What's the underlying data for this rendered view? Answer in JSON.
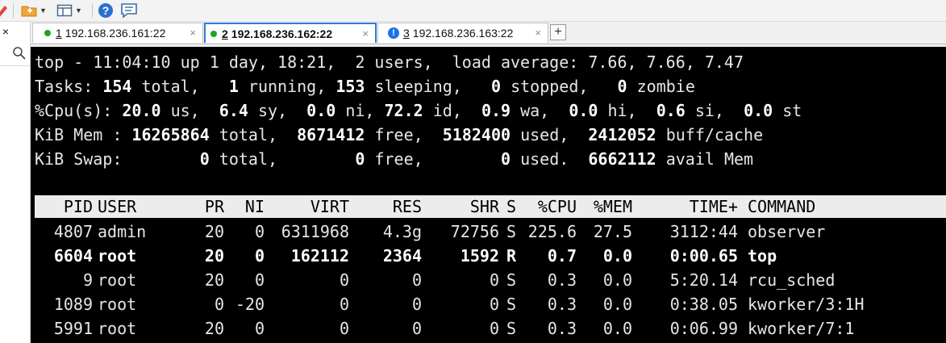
{
  "tabs": [
    {
      "num": "1",
      "label": "192.168.236.161:22",
      "status": "connected",
      "color": "#1fa51f"
    },
    {
      "num": "2",
      "label": "192.168.236.162:22",
      "status": "connected",
      "color": "#1fa51f"
    },
    {
      "num": "3",
      "label": "192.168.236.163:22",
      "status": "warning",
      "icon": "!"
    }
  ],
  "add_tab_label": "+",
  "close_glyph": "×",
  "left_close_glyph": "×",
  "summary": {
    "l1": {
      "prefix": "top - 11:04:10 up 1 day, 18:21,  2 users,  load average: 7.66, 7.66, 7.47"
    },
    "l2": {
      "a": "Tasks: ",
      "total": "154",
      "b": " total,   ",
      "running": "1",
      "c": " running, ",
      "sleeping": "153",
      "d": " sleeping,   ",
      "stopped": "0",
      "e": " stopped,   ",
      "zombie": "0",
      "f": " zombie"
    },
    "l3": {
      "a": "%Cpu(s): ",
      "us": "20.0",
      "b": " us,  ",
      "sy": "6.4",
      "c": " sy,  ",
      "ni": "0.0",
      "d": " ni, ",
      "id": "72.2",
      "e": " id,  ",
      "wa": "0.9",
      "f": " wa,  ",
      "hi": "0.0",
      "g": " hi,  ",
      "si": "0.6",
      "h": " si,  ",
      "st": "0.0",
      "i": " st"
    },
    "l4": {
      "a": "KiB Mem : ",
      "total": "16265864",
      "b": " total,  ",
      "free": "8671412",
      "c": " free,  ",
      "used": "5182400",
      "d": " used,  ",
      "buff": "2412052",
      "e": " buff/cache"
    },
    "l5": {
      "a": "KiB Swap:        ",
      "total": "0",
      "b": " total,        ",
      "free": "0",
      "c": " free,        ",
      "used": "0",
      "d": " used.  ",
      "avail": "6662112",
      "e": " avail Mem"
    }
  },
  "columns": [
    "PID",
    "USER",
    "PR",
    "NI",
    "VIRT",
    "RES",
    "SHR",
    "S",
    "%CPU",
    "%MEM",
    "TIME+",
    "COMMAND"
  ],
  "processes": [
    {
      "pid": "4807",
      "user": "admin",
      "pr": "20",
      "ni": "0",
      "virt": "6311968",
      "res": "4.3g",
      "shr": "72756",
      "s": "S",
      "cpu": "225.6",
      "mem": "27.5",
      "time": "3112:44",
      "cmd": "observer",
      "highlight": false
    },
    {
      "pid": "6604",
      "user": "root",
      "pr": "20",
      "ni": "0",
      "virt": "162112",
      "res": "2364",
      "shr": "1592",
      "s": "R",
      "cpu": "0.7",
      "mem": "0.0",
      "time": "0:00.65",
      "cmd": "top",
      "highlight": true
    },
    {
      "pid": "9",
      "user": "root",
      "pr": "20",
      "ni": "0",
      "virt": "0",
      "res": "0",
      "shr": "0",
      "s": "S",
      "cpu": "0.3",
      "mem": "0.0",
      "time": "5:20.14",
      "cmd": "rcu_sched",
      "highlight": false
    },
    {
      "pid": "1089",
      "user": "root",
      "pr": "0",
      "ni": "-20",
      "virt": "0",
      "res": "0",
      "shr": "0",
      "s": "S",
      "cpu": "0.3",
      "mem": "0.0",
      "time": "0:38.05",
      "cmd": "kworker/3:1H",
      "highlight": false
    },
    {
      "pid": "5991",
      "user": "root",
      "pr": "20",
      "ni": "0",
      "virt": "0",
      "res": "0",
      "shr": "0",
      "s": "S",
      "cpu": "0.3",
      "mem": "0.0",
      "time": "0:06.99",
      "cmd": "kworker/7:1",
      "highlight": false
    }
  ],
  "icons": {
    "toolbar": [
      "pencil-icon",
      "new-folder-icon",
      "layout-icon",
      "help-icon",
      "chat-icon"
    ],
    "left": [
      "close-icon",
      "search-icon"
    ]
  }
}
